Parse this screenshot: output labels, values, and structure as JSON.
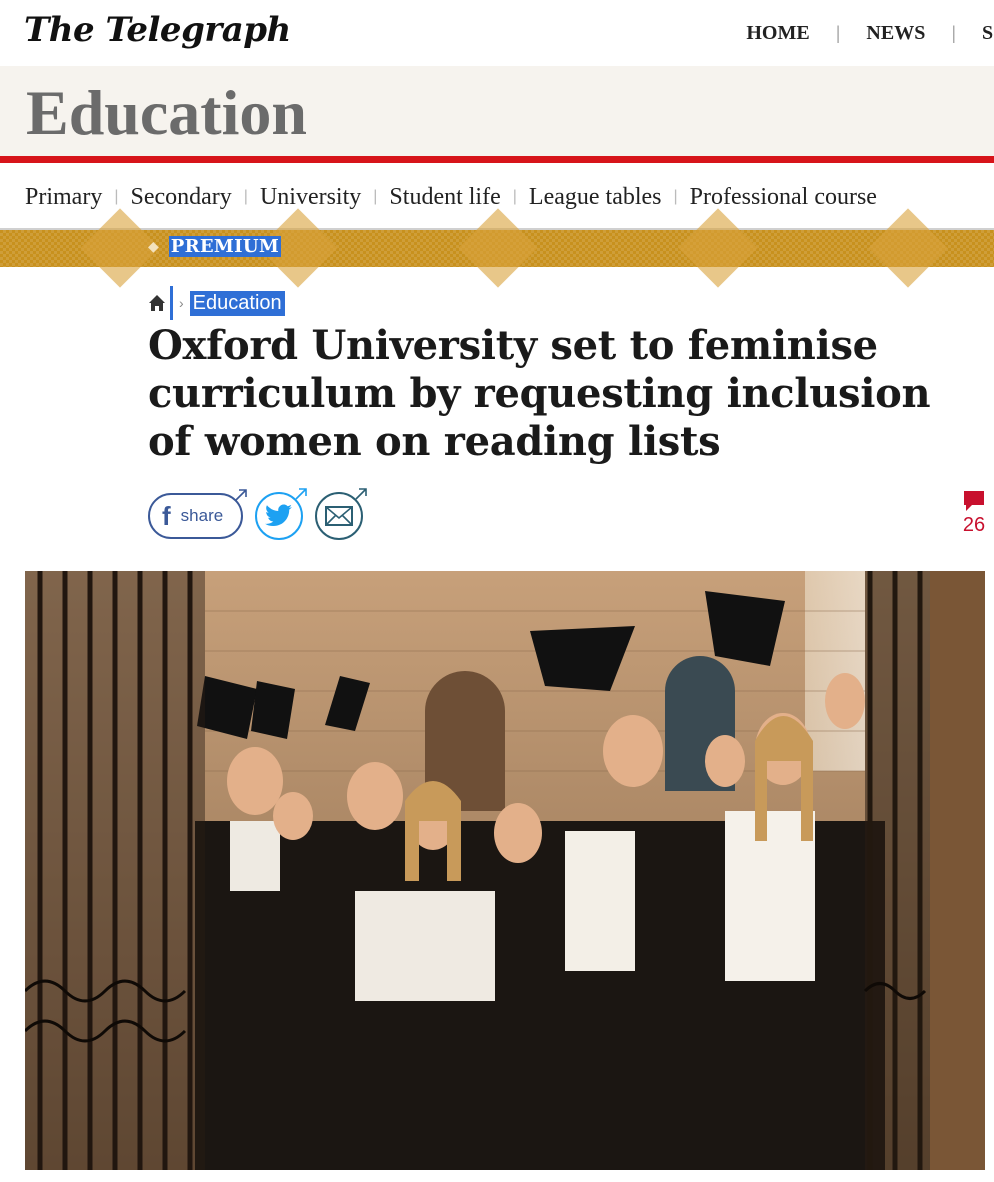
{
  "header": {
    "logo": "The Telegraph",
    "nav": [
      "HOME",
      "NEWS",
      "S"
    ]
  },
  "section": {
    "title": "Education"
  },
  "subnav": {
    "items": [
      "Primary",
      "Secondary",
      "University",
      "Student life",
      "League tables",
      "Professional course"
    ]
  },
  "premium": {
    "label": "PREMIUM"
  },
  "breadcrumb": {
    "home_icon": "home-icon",
    "section": "Education"
  },
  "article": {
    "headline": "Oxford University set to feminise curriculum by requesting inclusion of women on reading lists"
  },
  "share": {
    "facebook_label": "share",
    "facebook_icon": "facebook-icon",
    "twitter_icon": "twitter-icon",
    "email_icon": "email-icon"
  },
  "comments": {
    "icon": "comment-icon",
    "count": "26"
  },
  "image": {
    "subject": "Oxford graduates in academic gowns throwing mortarboards at a gate"
  },
  "colors": {
    "brand_red": "#d7141a",
    "premium_gold": "#c8911e",
    "selection_blue": "#2f6fd6",
    "facebook_blue": "#3b5998",
    "twitter_blue": "#1da1f2",
    "comment_red": "#c8102e"
  }
}
